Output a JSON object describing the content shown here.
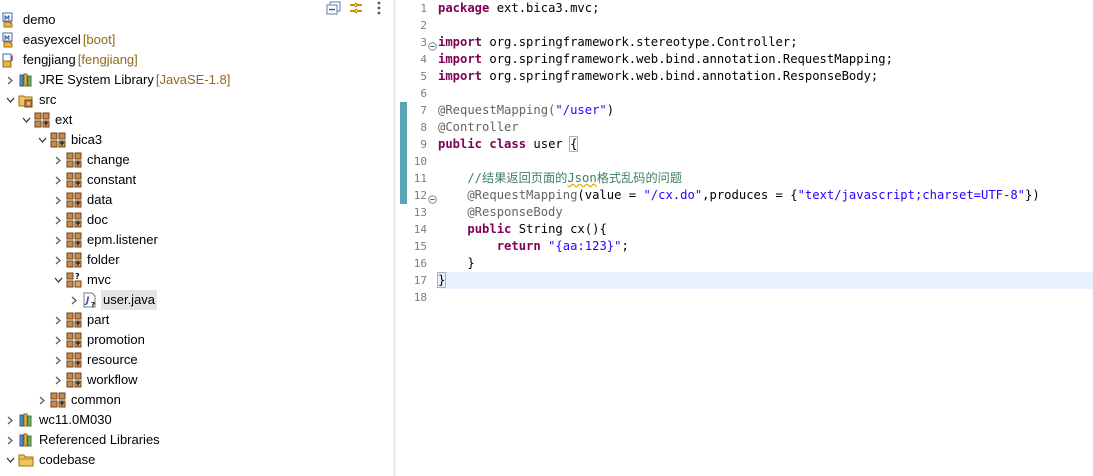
{
  "explorer": {
    "toolbar": {
      "collapse_all": "collapse-all-icon",
      "link_with_editor": "link-with-editor-icon",
      "view_menu": "view-menu-icon"
    },
    "items": [
      {
        "label": "demo",
        "suffix": "",
        "depth": 0,
        "arrow": "none",
        "icon": "maven-project-icon"
      },
      {
        "label": "easyexcel",
        "suffix": "[boot]",
        "depth": 0,
        "arrow": "none",
        "icon": "maven-project-icon"
      },
      {
        "label": "fengjiang",
        "suffix": "[fengjiang]",
        "depth": 0,
        "arrow": "none",
        "icon": "project-icon"
      },
      {
        "label": "JRE System Library",
        "suffix": "[JavaSE-1.8]",
        "depth": 0,
        "arrow": "collapsed",
        "icon": "library-icon"
      },
      {
        "label": "src",
        "suffix": "",
        "depth": 0,
        "arrow": "expanded",
        "icon": "package-folder-icon"
      },
      {
        "label": "ext",
        "suffix": "",
        "depth": 1,
        "arrow": "expanded",
        "icon": "package-icon"
      },
      {
        "label": "bica3",
        "suffix": "",
        "depth": 2,
        "arrow": "expanded",
        "icon": "package-icon"
      },
      {
        "label": "change",
        "suffix": "",
        "depth": 3,
        "arrow": "collapsed",
        "icon": "package-icon"
      },
      {
        "label": "constant",
        "suffix": "",
        "depth": 3,
        "arrow": "collapsed",
        "icon": "package-icon"
      },
      {
        "label": "data",
        "suffix": "",
        "depth": 3,
        "arrow": "collapsed",
        "icon": "package-icon"
      },
      {
        "label": "doc",
        "suffix": "",
        "depth": 3,
        "arrow": "collapsed",
        "icon": "package-icon"
      },
      {
        "label": "epm.listener",
        "suffix": "",
        "depth": 3,
        "arrow": "collapsed",
        "icon": "package-icon"
      },
      {
        "label": "folder",
        "suffix": "",
        "depth": 3,
        "arrow": "collapsed",
        "icon": "package-icon"
      },
      {
        "label": "mvc",
        "suffix": "",
        "depth": 3,
        "arrow": "expanded",
        "icon": "package-unsaved-icon"
      },
      {
        "label": "user.java",
        "suffix": "",
        "depth": 4,
        "arrow": "collapsed",
        "icon": "java-file-icon",
        "selected": true
      },
      {
        "label": "part",
        "suffix": "",
        "depth": 3,
        "arrow": "collapsed",
        "icon": "package-icon"
      },
      {
        "label": "promotion",
        "suffix": "",
        "depth": 3,
        "arrow": "collapsed",
        "icon": "package-icon"
      },
      {
        "label": "resource",
        "suffix": "",
        "depth": 3,
        "arrow": "collapsed",
        "icon": "package-icon"
      },
      {
        "label": "workflow",
        "suffix": "",
        "depth": 3,
        "arrow": "collapsed",
        "icon": "package-icon"
      },
      {
        "label": "common",
        "suffix": "",
        "depth": 2,
        "arrow": "collapsed",
        "icon": "package-icon"
      },
      {
        "label": "wc11.0M030",
        "suffix": "",
        "depth": 0,
        "arrow": "collapsed",
        "icon": "library-icon"
      },
      {
        "label": "Referenced Libraries",
        "suffix": "",
        "depth": 0,
        "arrow": "collapsed",
        "icon": "library-icon"
      },
      {
        "label": "codebase",
        "suffix": "",
        "depth": 0,
        "arrow": "expanded",
        "icon": "folder-icon"
      }
    ]
  },
  "editor": {
    "current_line": 17,
    "lines": [
      {
        "n": "1",
        "tokens": [
          {
            "t": "package",
            "c": "kw"
          },
          {
            "t": " ext.bica3.mvc;",
            "c": ""
          }
        ]
      },
      {
        "n": "2",
        "tokens": []
      },
      {
        "n": "3",
        "fold": true,
        "tokens": [
          {
            "t": "import",
            "c": "kw"
          },
          {
            "t": " org.springframework.stereotype.Controller;",
            "c": ""
          }
        ]
      },
      {
        "n": "4",
        "tokens": [
          {
            "t": "import",
            "c": "kw"
          },
          {
            "t": " org.springframework.web.bind.annotation.RequestMapping;",
            "c": ""
          }
        ]
      },
      {
        "n": "5",
        "tokens": [
          {
            "t": "import",
            "c": "kw"
          },
          {
            "t": " org.springframework.web.bind.annotation.ResponseBody;",
            "c": ""
          }
        ]
      },
      {
        "n": "6",
        "tokens": []
      },
      {
        "n": "7",
        "tokens": [
          {
            "t": "@RequestMapping(",
            "c": "ann"
          },
          {
            "t": "\"/user\"",
            "c": "str"
          },
          {
            "t": ")",
            "c": ""
          }
        ]
      },
      {
        "n": "8",
        "tokens": [
          {
            "t": "@Controller",
            "c": "ann"
          }
        ]
      },
      {
        "n": "9",
        "tokens": [
          {
            "t": "public",
            "c": "kw"
          },
          {
            "t": " ",
            "c": ""
          },
          {
            "t": "class",
            "c": "kw"
          },
          {
            "t": " user ",
            "c": ""
          },
          {
            "t": "{",
            "c": "bracket"
          }
        ]
      },
      {
        "n": "10",
        "tokens": []
      },
      {
        "n": "11",
        "tokens": [
          {
            "t": "    //结果返回页面的",
            "c": "cmt"
          },
          {
            "t": "Json",
            "c": "cmt spell"
          },
          {
            "t": "格式乱码的问题",
            "c": "cmt"
          }
        ]
      },
      {
        "n": "12",
        "fold": true,
        "tokens": [
          {
            "t": "    @RequestMapping",
            "c": "ann"
          },
          {
            "t": "(value = ",
            "c": ""
          },
          {
            "t": "\"/cx.do\"",
            "c": "str"
          },
          {
            "t": ",produces = {",
            "c": ""
          },
          {
            "t": "\"text/javascript;charset=UTF-8\"",
            "c": "str"
          },
          {
            "t": "})",
            "c": ""
          }
        ]
      },
      {
        "n": "13",
        "tokens": [
          {
            "t": "    @ResponseBody",
            "c": "ann"
          }
        ]
      },
      {
        "n": "14",
        "tokens": [
          {
            "t": "    ",
            "c": ""
          },
          {
            "t": "public",
            "c": "kw"
          },
          {
            "t": " String cx(){",
            "c": ""
          }
        ]
      },
      {
        "n": "15",
        "tokens": [
          {
            "t": "        ",
            "c": ""
          },
          {
            "t": "return",
            "c": "kw"
          },
          {
            "t": " ",
            "c": ""
          },
          {
            "t": "\"{aa:123}\"",
            "c": "str"
          },
          {
            "t": ";",
            "c": ""
          }
        ]
      },
      {
        "n": "16",
        "tokens": [
          {
            "t": "    }",
            "c": ""
          }
        ]
      },
      {
        "n": "17",
        "tokens": [
          {
            "t": "}",
            "c": "bracket"
          }
        ]
      },
      {
        "n": "18",
        "tokens": []
      }
    ]
  }
}
